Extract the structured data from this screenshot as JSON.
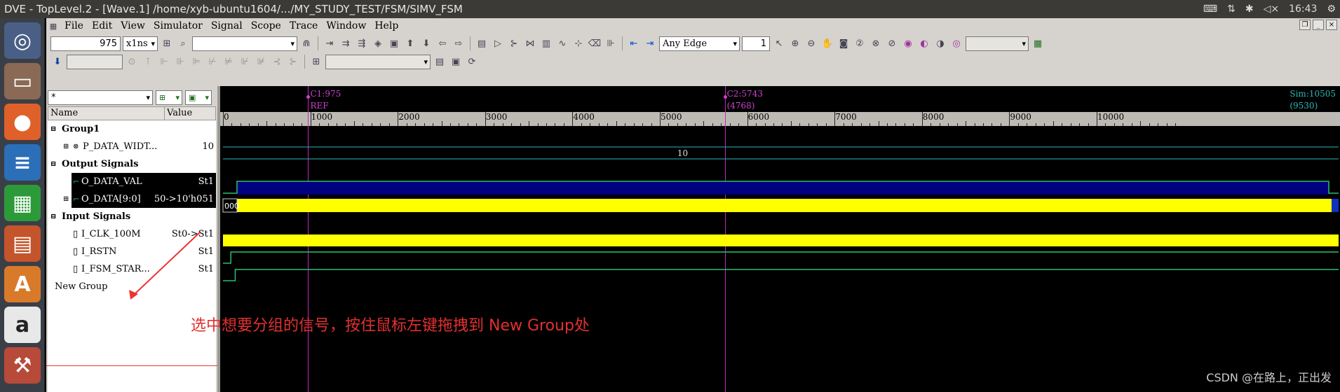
{
  "window": {
    "title": "DVE - TopLevel.2 - [Wave.1]  /home/xyb-ubuntu1604/.../MY_STUDY_TEST/FSM/SIMV_FSM",
    "time": "16:43"
  },
  "menu": [
    "File",
    "Edit",
    "View",
    "Simulator",
    "Signal",
    "Scope",
    "Trace",
    "Window",
    "Help"
  ],
  "toolbar": {
    "time_value": "975",
    "time_unit": "x1ns",
    "edge_mode": "Any Edge",
    "edge_count": "1"
  },
  "filter": {
    "value": "*"
  },
  "columns": {
    "name": "Name",
    "value": "Value"
  },
  "signals": [
    {
      "name": "Group1",
      "value": "",
      "kind": "group"
    },
    {
      "name": "P_DATA_WIDT...",
      "value": "10",
      "kind": "param"
    },
    {
      "name": "Output Signals",
      "value": "",
      "kind": "group"
    },
    {
      "name": "O_DATA_VAL",
      "value": "St1",
      "kind": "selected"
    },
    {
      "name": "O_DATA[9:0]",
      "value": "50->10'h051",
      "kind": "selected"
    },
    {
      "name": "Input Signals",
      "value": "",
      "kind": "group"
    },
    {
      "name": "I_CLK_100M",
      "value": "St0->St1",
      "kind": "input"
    },
    {
      "name": "I_RSTN",
      "value": "St1",
      "kind": "input"
    },
    {
      "name": "I_FSM_STAR...",
      "value": "St1",
      "kind": "input"
    },
    {
      "name": "New Group",
      "value": "",
      "kind": "new"
    }
  ],
  "cursors": [
    {
      "label": "C1:975",
      "sub": "REF",
      "time": 975
    },
    {
      "label": "C2:5743",
      "sub": "(4768)",
      "time": 5743
    }
  ],
  "sim": {
    "label": "Sim:10505",
    "sub": "(9530)"
  },
  "timeline": {
    "start": 0,
    "end": 10505,
    "ticks": [
      "0",
      "1000",
      "2000",
      "3000",
      "4000",
      "5000",
      "6000",
      "7000",
      "8000",
      "9000",
      "10000"
    ]
  },
  "waves": {
    "param_value": "10",
    "bus_start_value": "000"
  },
  "colors": {
    "selected_bg": "#000000",
    "clock": "#ffff00",
    "bus": "#ffff00",
    "val_fill": "#000080",
    "line": "#2ac070",
    "cursor": "#c028c0"
  },
  "annotation": "选中想要分组的信号，按住鼠标左键拖拽到 New Group处",
  "watermark": "CSDN @在路上，正出发"
}
